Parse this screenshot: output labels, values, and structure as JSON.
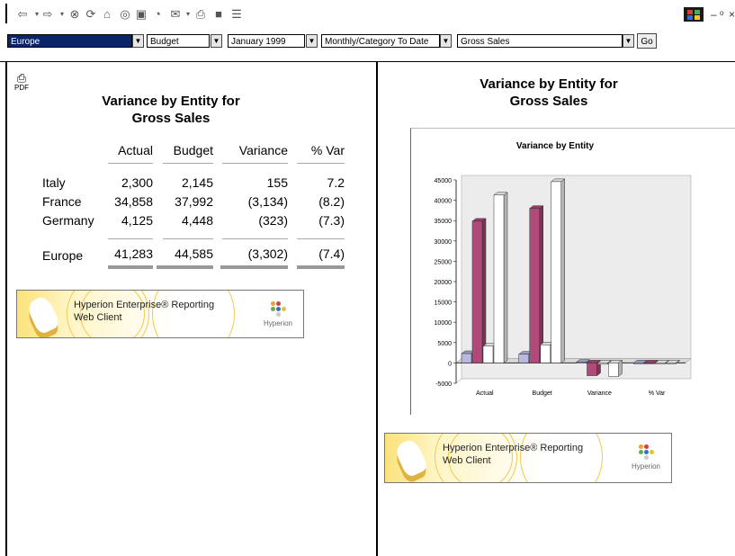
{
  "toolbar": {
    "icons": [
      "back-icon",
      "forward-icon",
      "stop-icon",
      "refresh-icon",
      "home-icon",
      "search-icon",
      "favorites-icon",
      "history-icon",
      "mail-icon",
      "print-icon",
      "edit-icon",
      "discuss-icon"
    ],
    "window_controls": [
      "–",
      "ᵒ",
      "×"
    ]
  },
  "selectors": {
    "entity": "Europe",
    "scenario": "Budget",
    "period": "January 1999",
    "view": "Monthly/Category To Date",
    "account": "Gross Sales",
    "go_label": "Go"
  },
  "left": {
    "pdf_label": "PDF",
    "title_line1": "Variance by Entity for",
    "title_line2": "Gross Sales",
    "columns": [
      "Actual",
      "Budget",
      "Variance",
      "% Var"
    ],
    "rows": [
      {
        "entity": "Italy",
        "actual": "2,300",
        "budget": "2,145",
        "variance": "155",
        "pct": "7.2"
      },
      {
        "entity": "France",
        "actual": "34,858",
        "budget": "37,992",
        "variance": "(3,134)",
        "pct": "(8.2)"
      },
      {
        "entity": "Germany",
        "actual": "4,125",
        "budget": "4,448",
        "variance": "(323)",
        "pct": "(7.3)"
      }
    ],
    "total": {
      "entity": "Europe",
      "actual": "41,283",
      "budget": "44,585",
      "variance": "(3,302)",
      "pct": "(7.4)"
    }
  },
  "right": {
    "title_line1": "Variance by Entity for",
    "title_line2": "Gross Sales"
  },
  "banner": {
    "line1": "Hyperion Enterprise® Reporting",
    "line2": "Web Client",
    "logo_text": "Hyperion"
  },
  "colors": {
    "italy": "#b8b8e0",
    "france": "#b04a78",
    "germany": "#ffffff",
    "selected": "#0a246a"
  },
  "chart_data": {
    "type": "bar",
    "title": "Variance by Entity",
    "categories": [
      "Actual",
      "Budget",
      "Variance",
      "% Var"
    ],
    "series": [
      {
        "values": [
          2300,
          2145,
          155,
          7.2
        ]
      },
      {
        "values": [
          34858,
          37992,
          -3134,
          -8.2
        ]
      },
      {
        "values": [
          4125,
          4448,
          -323,
          -7.3
        ]
      },
      {
        "values": [
          41283,
          44585,
          -3302,
          -7.4
        ]
      }
    ],
    "yticks": [
      45000,
      40000,
      35000,
      30000,
      25000,
      20000,
      15000,
      10000,
      5000,
      0,
      -5000
    ],
    "ylim": [
      -5000,
      45000
    ],
    "grid": false,
    "legend": "none"
  }
}
